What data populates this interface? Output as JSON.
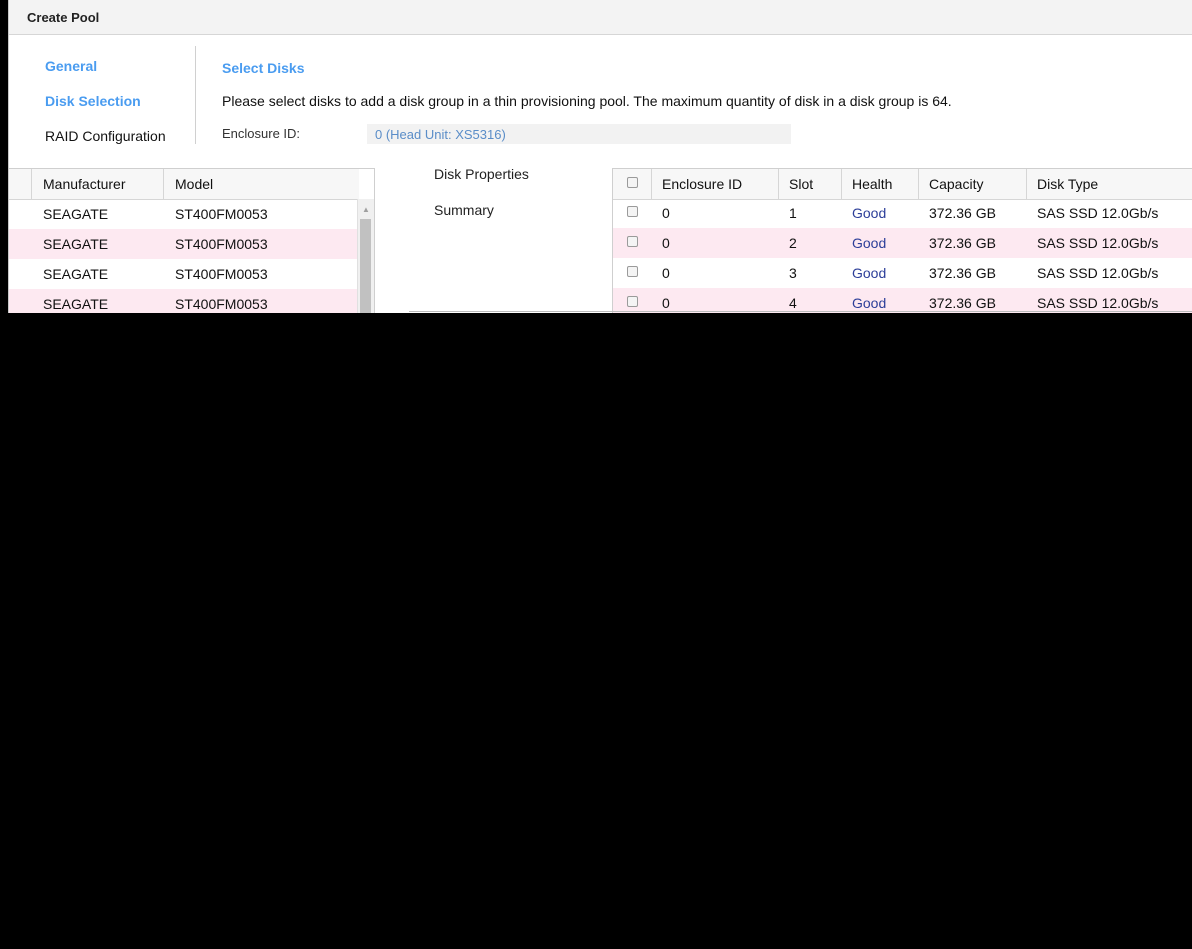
{
  "dialog": {
    "title": "Create Pool"
  },
  "nav": {
    "items": [
      {
        "label": "General",
        "active": true
      },
      {
        "label": "Disk Selection",
        "active": true
      },
      {
        "label": "RAID Configuration",
        "active": false
      }
    ]
  },
  "content": {
    "section_title": "Select Disks",
    "instruction": "Please select disks to add a disk group in a thin provisioning pool. The maximum quantity of disk in a disk group is 64.",
    "enclosure_label": "Enclosure ID:",
    "enclosure_value": "0 (Head Unit: XS5316)"
  },
  "left_table": {
    "columns": [
      "Manufacturer",
      "Model"
    ],
    "rows": [
      {
        "manufacturer": "SEAGATE",
        "model": "ST400FM0053"
      },
      {
        "manufacturer": "SEAGATE",
        "model": "ST400FM0053"
      },
      {
        "manufacturer": "SEAGATE",
        "model": "ST400FM0053"
      },
      {
        "manufacturer": "SEAGATE",
        "model": "ST400FM0053"
      }
    ]
  },
  "middle_links": [
    "Disk Properties",
    "Summary"
  ],
  "right_table": {
    "columns": [
      "Enclosure ID",
      "Slot",
      "Health",
      "Capacity",
      "Disk Type"
    ],
    "rows": [
      {
        "enclosure_id": "0",
        "slot": "1",
        "health": "Good",
        "capacity": "372.36 GB",
        "disk_type": "SAS SSD 12.0Gb/s"
      },
      {
        "enclosure_id": "0",
        "slot": "2",
        "health": "Good",
        "capacity": "372.36 GB",
        "disk_type": "SAS SSD 12.0Gb/s"
      },
      {
        "enclosure_id": "0",
        "slot": "3",
        "health": "Good",
        "capacity": "372.36 GB",
        "disk_type": "SAS SSD 12.0Gb/s"
      },
      {
        "enclosure_id": "0",
        "slot": "4",
        "health": "Good",
        "capacity": "372.36 GB",
        "disk_type": "SAS SSD 12.0Gb/s"
      }
    ]
  },
  "colors": {
    "accent": "#4a9cf0",
    "row_pink": "#fde9f1",
    "health_text": "#2c3e99"
  }
}
